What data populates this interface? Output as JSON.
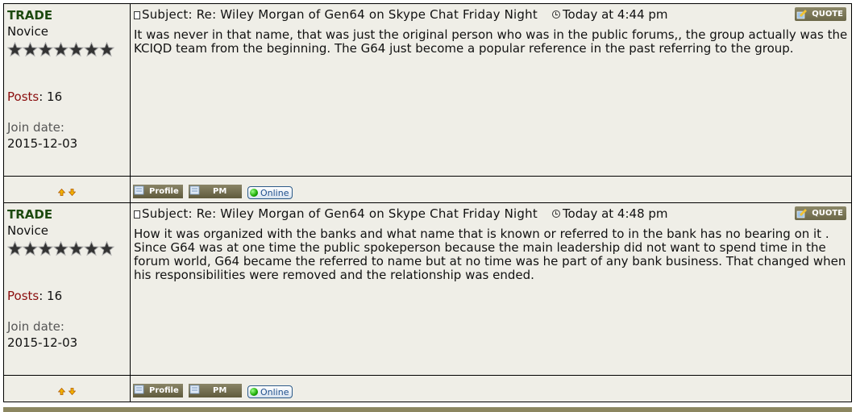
{
  "posts": [
    {
      "author": {
        "name": "TRADE",
        "rank": "Novice",
        "stars": 7,
        "posts_label": "Posts",
        "posts_sep": ": ",
        "posts_count": "16",
        "join_label": "Join date:",
        "join_date": "2015-12-03"
      },
      "subject": "Subject: Re: Wiley Morgan of Gen64 on Skype Chat Friday Night",
      "time": "Today at 4:44 pm",
      "quote_label": "QUOTE",
      "body": "It was never in that name, that was just the original person who was in the public forums,, the group actually was the KCIQD team from the beginning. The G64 just become a popular reference in the past referring to the group.",
      "profile_label": "Profile",
      "pm_label": "PM",
      "status_label": "Online"
    },
    {
      "author": {
        "name": "TRADE",
        "rank": "Novice",
        "stars": 7,
        "posts_label": "Posts",
        "posts_sep": ": ",
        "posts_count": "16",
        "join_label": "Join date:",
        "join_date": "2015-12-03"
      },
      "subject": "Subject: Re: Wiley Morgan of Gen64 on Skype Chat Friday Night",
      "time": "Today at 4:48 pm",
      "quote_label": "QUOTE",
      "body": "How it was organized with the banks and what name that is known or referred to in the bank has no bearing on it . Since G64 was at one time the public spokeperson because the main leadership did not want to spend time in the forum world, G64 became the referred to name but at no time was he part of any bank business.  That changed when his responsibilities were removed and the relationship was ended.",
      "profile_label": "Profile",
      "pm_label": "PM",
      "status_label": "Online"
    }
  ],
  "colors": {
    "background": "#efeee7",
    "username": "#1d4a0f",
    "posts_label": "#8b0e0e",
    "button": "#7a7556",
    "online": "#1e4e8c"
  }
}
